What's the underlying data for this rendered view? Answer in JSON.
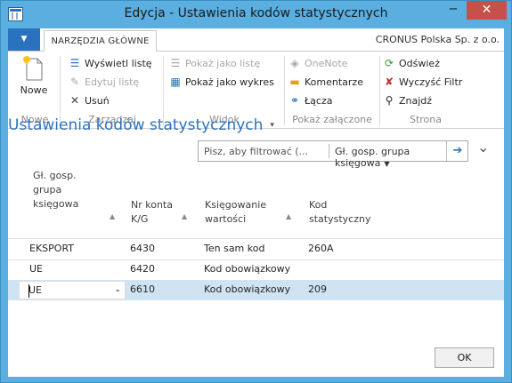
{
  "window": {
    "title": "Edycja - Ustawienia kodów statystycznych",
    "minimize": "−",
    "maximize": "☐",
    "close": "✕"
  },
  "ribbon_tabs": {
    "file_menu": "▼",
    "active_tab": "NARZĘDZIA GŁÓWNE",
    "company": "CRONUS Polska Sp. z o.o."
  },
  "ribbon": {
    "nowe": {
      "label": "Nowe",
      "group": "Nowe"
    },
    "zarzadzaj": {
      "group": "Zarządzaj",
      "wyswietl": "Wyświetl listę",
      "edytuj": "Edytuj listę",
      "usun": "Usuń"
    },
    "widok": {
      "group": "Widok",
      "pokaz_liste": "Pokaż jako listę",
      "pokaz_wykres": "Pokaż jako wykres"
    },
    "zalaczone": {
      "group": "Pokaż załączone",
      "onenote": "OneNote",
      "komentarze": "Komentarze",
      "lacza": "Łącza"
    },
    "strona": {
      "group": "Strona",
      "odswiez": "Odśwież",
      "wyczysc": "Wyczyść Filtr",
      "znajdz": "Znajdź"
    }
  },
  "page": {
    "title": "Ustawienia kodów statystycznych",
    "title_caret": "▾",
    "collapse": "⌄"
  },
  "search": {
    "placeholder": "Pisz, aby filtrować (...",
    "field": "Gł. gosp. grupa księgowa",
    "go": "➔"
  },
  "table": {
    "headers": [
      "Gł. gosp.\ngrupa\nksięgowa",
      "Nr konta\nK/G",
      "Księgowanie\nwartości",
      "Kod\nstatystyczny"
    ],
    "rows": [
      [
        "EKSPORT",
        "6430",
        "Ten sam kod",
        "260A"
      ],
      [
        "UE",
        "6420",
        "Kod obowiązkowy",
        ""
      ],
      [
        "UE",
        "6610",
        "Kod obowiązkowy",
        "209"
      ]
    ],
    "selected_row": 2
  },
  "footer": {
    "ok": "OK"
  },
  "colors": {
    "accent": "#2a71c0",
    "titlebar": "#5aafe0",
    "close": "#c7504a",
    "selection": "#cfe3f3"
  }
}
